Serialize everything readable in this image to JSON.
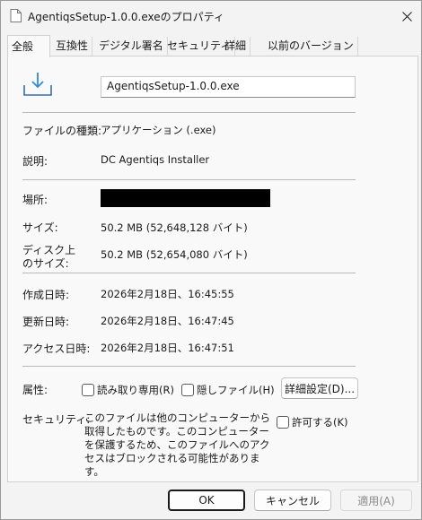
{
  "window": {
    "title": "AgentiqsSetup-1.0.0.exeのプロパティ",
    "close_icon": "close-icon"
  },
  "tabs": [
    {
      "label": "全般",
      "active": true
    },
    {
      "label": "互換性"
    },
    {
      "label": "デジタル署名"
    },
    {
      "label": "セキュリティ"
    },
    {
      "label": "詳細"
    },
    {
      "label": "以前のバージョン"
    }
  ],
  "general": {
    "file_icon": "download-installer-icon",
    "filename": "AgentiqsSetup-1.0.0.exe",
    "file_type_label": "ファイルの種類:",
    "file_type_value": "アプリケーション (.exe)",
    "description_label": "説明:",
    "description_value": "DC Agentiqs Installer",
    "location_label": "場所:",
    "size_label": "サイズ:",
    "size_value": "50.2 MB (52,648,128 バイト)",
    "size_on_disk_label_line1": "ディスク上",
    "size_on_disk_label_line2": "のサイズ:",
    "size_on_disk_value": "50.2 MB (52,654,080 バイト)",
    "created_label": "作成日時:",
    "created_value": "2026年2月18日、16:45:55",
    "modified_label": "更新日時:",
    "modified_value": "2026年2月18日、16:47:45",
    "accessed_label": "アクセス日時:",
    "accessed_value": "2026年2月18日、16:47:51",
    "attributes_label": "属性:",
    "readonly_label": "読み取り専用(R)",
    "hidden_label": "隠しファイル(H)",
    "advanced_button": "詳細設定(D)...",
    "security_label": "セキュリティ:",
    "security_text": "このファイルは他のコンピューターから取得したものです。このコンピューターを保護するため、このファイルへのアクセスはブロックされる可能性があります。",
    "unblock_label": "許可する(K)"
  },
  "buttons": {
    "ok": "OK",
    "cancel": "キャンセル",
    "apply": "適用(A)"
  }
}
